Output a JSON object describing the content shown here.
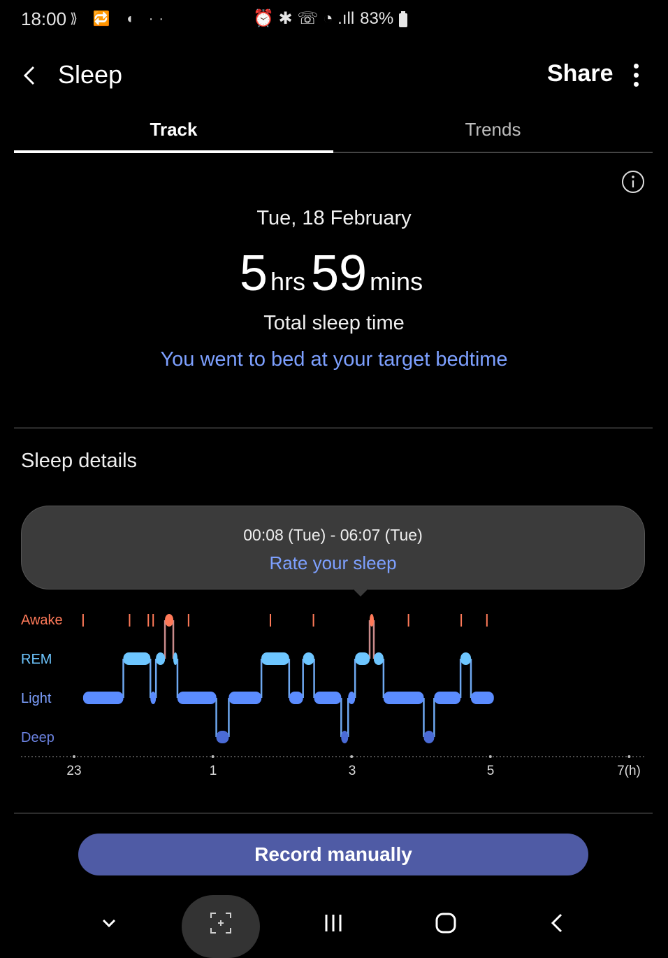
{
  "status_bar": {
    "time": "18:00",
    "left_icons": "⟫ 🔁 ◖ ··",
    "battery_text": "83%",
    "right_icons": "⏰ ✱ ☏ ◔ .ıll"
  },
  "header": {
    "title": "Sleep",
    "share_label": "Share",
    "back_icon": "back-arrow-icon",
    "more_icon": "more-vertical-icon"
  },
  "tabs": [
    {
      "label": "Track",
      "active": true
    },
    {
      "label": "Trends",
      "active": false
    }
  ],
  "summary": {
    "date": "Tue, 18 February",
    "hours": "5",
    "hours_unit": "hrs",
    "minutes": "59",
    "minutes_unit": "mins",
    "total_label": "Total sleep time",
    "bedtime_message": "You went to bed at your target bedtime"
  },
  "details": {
    "section_title": "Sleep details",
    "time_range": "00:08 (Tue) - 06:07 (Tue)",
    "rate_label": "Rate your sleep",
    "stages": [
      "Awake",
      "REM",
      "Light",
      "Deep"
    ],
    "stage_colors": {
      "Awake": "#ff7a59",
      "REM": "#6ec6ff",
      "Light": "#5b8cff",
      "Deep": "#4a6bd6"
    },
    "axis_ticks": [
      "23",
      "1",
      "3",
      "5",
      "7(h)"
    ]
  },
  "chart_data": {
    "type": "line",
    "title": "",
    "xlabel": "",
    "ylabel": "",
    "x_ticks": [
      "23",
      "1",
      "3",
      "5",
      "7(h)"
    ],
    "categories": [
      "Awake",
      "REM",
      "Light",
      "Deep"
    ],
    "segments": [
      {
        "stage": "Light",
        "start": 0.13,
        "end": 0.71
      },
      {
        "stage": "REM",
        "start": 0.71,
        "end": 1.1
      },
      {
        "stage": "Light",
        "start": 1.1,
        "end": 1.18
      },
      {
        "stage": "REM",
        "start": 1.18,
        "end": 1.31
      },
      {
        "stage": "Awake",
        "start": 1.31,
        "end": 1.43
      },
      {
        "stage": "REM",
        "start": 1.43,
        "end": 1.49
      },
      {
        "stage": "Light",
        "start": 1.49,
        "end": 2.05
      },
      {
        "stage": "Deep",
        "start": 2.05,
        "end": 2.23
      },
      {
        "stage": "Light",
        "start": 2.23,
        "end": 2.7
      },
      {
        "stage": "REM",
        "start": 2.7,
        "end": 3.1
      },
      {
        "stage": "Light",
        "start": 3.1,
        "end": 3.3
      },
      {
        "stage": "REM",
        "start": 3.3,
        "end": 3.46
      },
      {
        "stage": "Light",
        "start": 3.46,
        "end": 3.85
      },
      {
        "stage": "Deep",
        "start": 3.85,
        "end": 3.95
      },
      {
        "stage": "Light",
        "start": 3.95,
        "end": 4.05
      },
      {
        "stage": "REM",
        "start": 4.05,
        "end": 4.26
      },
      {
        "stage": "Awake",
        "start": 4.26,
        "end": 4.32
      },
      {
        "stage": "REM",
        "start": 4.32,
        "end": 4.46
      },
      {
        "stage": "Light",
        "start": 4.46,
        "end": 5.04
      },
      {
        "stage": "Deep",
        "start": 5.04,
        "end": 5.19
      },
      {
        "stage": "Light",
        "start": 5.19,
        "end": 5.57
      },
      {
        "stage": "REM",
        "start": 5.57,
        "end": 5.72
      },
      {
        "stage": "Light",
        "start": 5.72,
        "end": 6.05
      }
    ],
    "awake_marks": [
      0.13,
      0.8,
      1.07,
      1.14,
      1.65,
      2.83,
      3.45,
      4.82,
      5.58,
      5.95
    ]
  },
  "actions": {
    "record_manually": "Record manually"
  },
  "nav_bar": {
    "items": [
      "chevron-down-icon",
      "screenshot-icon",
      "recents-icon",
      "home-icon",
      "back-icon"
    ]
  }
}
